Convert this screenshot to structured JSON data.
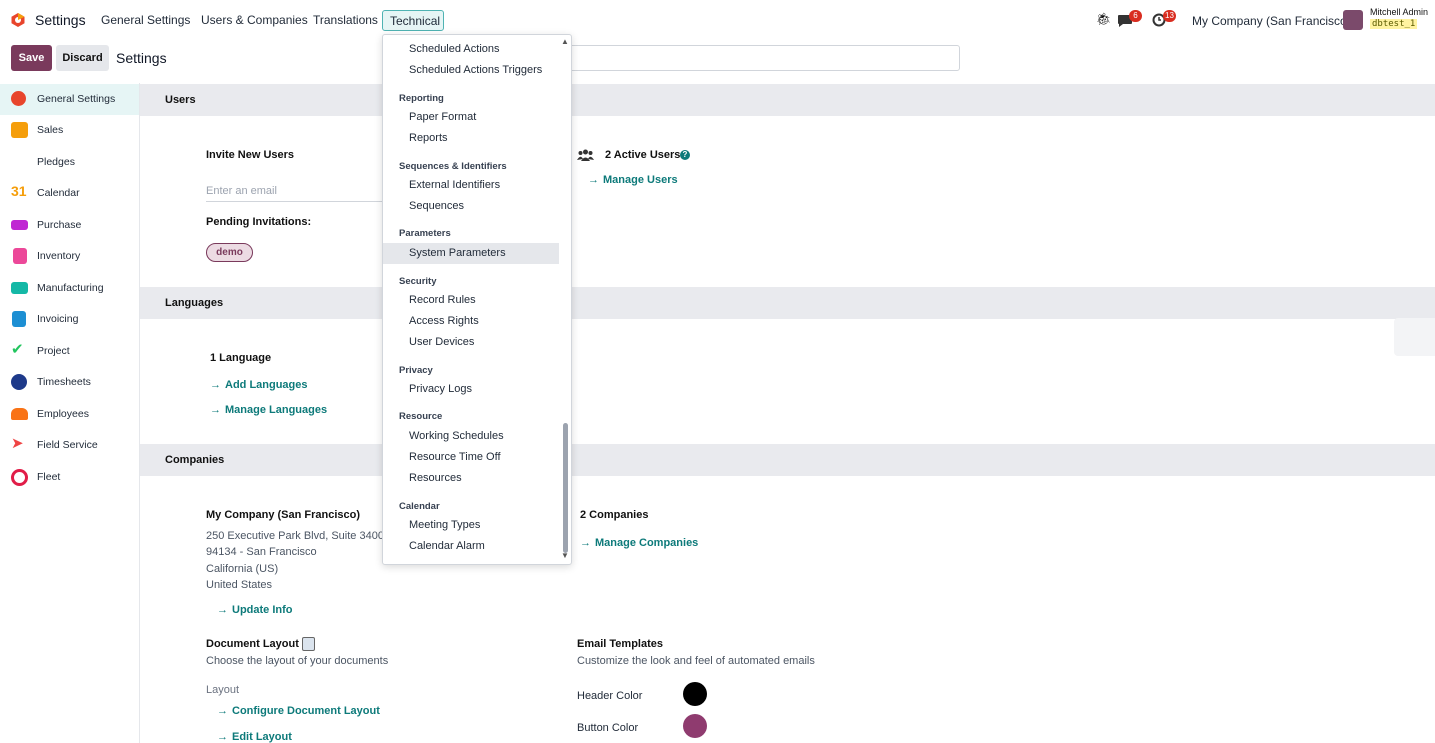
{
  "topbar": {
    "app_title": "Settings",
    "menu": [
      "General Settings",
      "Users & Companies",
      "Translations"
    ],
    "active_menu": "Technical",
    "messages_badge": "6",
    "activities_badge": "13",
    "company": "My Company (San Francisco)",
    "user_name": "Mitchell Admin",
    "db_name": "dbtest_1"
  },
  "control": {
    "save_label": "Save",
    "discard_label": "Discard",
    "breadcrumb": "Settings"
  },
  "sidebar": {
    "items": [
      {
        "label": "General Settings",
        "icon": "settings-logo-icon",
        "color": "#e8452c"
      },
      {
        "label": "Sales",
        "icon": "sales-icon",
        "color": "#f59e0b"
      },
      {
        "label": "Pledges",
        "icon": "",
        "color": ""
      },
      {
        "label": "Calendar",
        "icon": "calendar-icon",
        "color": "#f59e0b"
      },
      {
        "label": "Purchase",
        "icon": "purchase-icon",
        "color": "#c026d3"
      },
      {
        "label": "Inventory",
        "icon": "inventory-icon",
        "color": "#ec4899"
      },
      {
        "label": "Manufacturing",
        "icon": "manufacturing-icon",
        "color": "#14b8a6"
      },
      {
        "label": "Invoicing",
        "icon": "invoicing-icon",
        "color": "#1d8fd3"
      },
      {
        "label": "Project",
        "icon": "project-icon",
        "color": "#22c55e"
      },
      {
        "label": "Timesheets",
        "icon": "timesheets-icon",
        "color": "#1e3a8a"
      },
      {
        "label": "Employees",
        "icon": "employees-icon",
        "color": "#f97316"
      },
      {
        "label": "Field Service",
        "icon": "field-service-icon",
        "color": "#ef4444"
      },
      {
        "label": "Fleet",
        "icon": "fleet-icon",
        "color": "#e11d48"
      }
    ]
  },
  "users": {
    "section_title": "Users",
    "invite_title": "Invite New Users",
    "email_placeholder": "Enter an email",
    "pending_title": "Pending Invitations:",
    "pending_tag": "demo",
    "active_users": "2 Active Users",
    "manage_users": "Manage Users"
  },
  "languages": {
    "section_title": "Languages",
    "count": "1 Language",
    "add": "Add Languages",
    "manage": "Manage Languages"
  },
  "companies": {
    "section_title": "Companies",
    "company_name": "My Company (San Francisco)",
    "address_lines": [
      "250 Executive Park Blvd, Suite 3400",
      "94134 - San Francisco",
      "California (US)",
      "United States"
    ],
    "update_info": "Update Info",
    "count": "2 Companies",
    "manage": "Manage Companies",
    "doc_layout_title": "Document Layout",
    "doc_layout_desc": "Choose the layout of your documents",
    "layout_label": "Layout",
    "configure_layout": "Configure Document Layout",
    "edit_layout": "Edit Layout",
    "email_templates_title": "Email Templates",
    "email_templates_desc": "Customize the look and feel of automated emails",
    "header_color_label": "Header Color",
    "header_color": "#000000",
    "button_color_label": "Button Color",
    "button_color": "#8f3b6f"
  },
  "dropdown": {
    "groups": [
      {
        "items": [
          "Scheduled Actions",
          "Scheduled Actions Triggers"
        ]
      },
      {
        "heading": "Reporting",
        "items": [
          "Paper Format",
          "Reports"
        ]
      },
      {
        "heading": "Sequences & Identifiers",
        "items": [
          "External Identifiers",
          "Sequences"
        ]
      },
      {
        "heading": "Parameters",
        "items": [
          "System Parameters"
        ]
      },
      {
        "heading": "Security",
        "items": [
          "Record Rules",
          "Access Rights",
          "User Devices"
        ]
      },
      {
        "heading": "Privacy",
        "items": [
          "Privacy Logs"
        ]
      },
      {
        "heading": "Resource",
        "items": [
          "Working Schedules",
          "Resource Time Off",
          "Resources"
        ]
      },
      {
        "heading": "Calendar",
        "items": [
          "Meeting Types",
          "Calendar Alarm"
        ]
      }
    ],
    "highlighted": "System Parameters"
  }
}
